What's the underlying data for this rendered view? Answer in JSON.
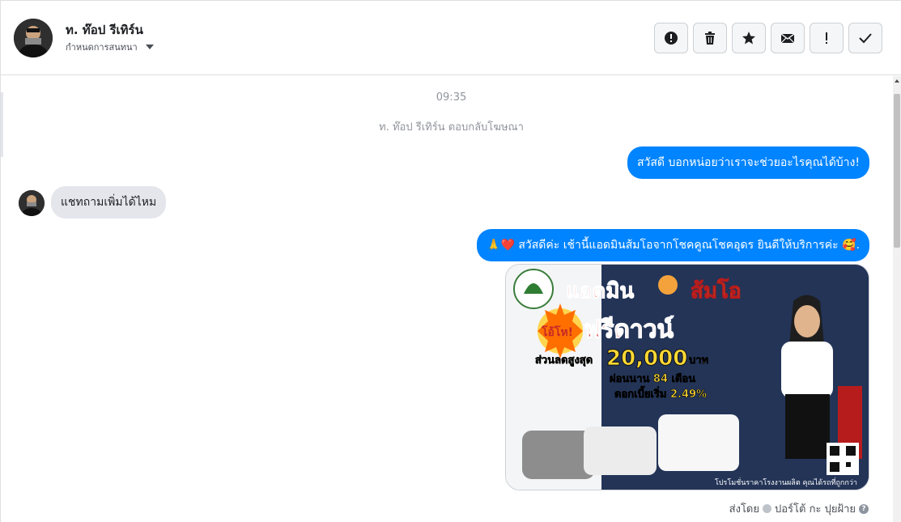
{
  "header": {
    "contact_name": "ท. ท๊อป รีเทิร์น",
    "assign_label": "กำหนดการสนทนา",
    "actions": [
      {
        "icon": "alert-circle-icon",
        "name": "mark-spam-button"
      },
      {
        "icon": "trash-icon",
        "name": "delete-button"
      },
      {
        "icon": "star-icon",
        "name": "star-button"
      },
      {
        "icon": "envelope-icon",
        "name": "mark-unread-button"
      },
      {
        "icon": "exclamation-icon",
        "name": "follow-up-button"
      },
      {
        "icon": "check-icon",
        "name": "mark-done-button"
      }
    ]
  },
  "thread": {
    "timestamp": "09:35",
    "system_message": "ท. ท๊อป รีเทิร์น ตอบกลับโฆษณา",
    "messages": [
      {
        "direction": "out",
        "text": "สวัสดี บอกหน่อยว่าเราจะช่วยอะไรคุณได้บ้าง!"
      },
      {
        "direction": "in",
        "text": "แชทถามเพิ่มได้ไหม"
      },
      {
        "direction": "out",
        "text": "🙏❤️ สวัสดีค่ะ เช้านี้แอดมินส้มโอจากโชคคูณโชคอุดร ยินดีให้บริการค่ะ 🥰."
      }
    ],
    "ad": {
      "headline": "แอดมิน",
      "headline2": "ส้มโอ",
      "badge": "โอ้โห!",
      "promo": "ฟรีดาวน์",
      "discount_label": "ส่วนลดสูงสุด",
      "discount_value": "20,000",
      "discount_unit": "บาท",
      "installment": "ผ่อนนาน 84 เดือน",
      "interest": "ดอกเบี้ยเริ่ม 2.49%",
      "footer": "โปรโมชั่นราคาโรงงานผลิต คุณได้รถที่ถูกกว่า"
    },
    "sent_by_label": "ส่งโดย",
    "sent_by_name": "ปอร์โต้ กะ ปุยฝ้าย"
  },
  "colors": {
    "accent": "#0084ff",
    "incoming_bubble": "#e4e6eb",
    "muted_text": "#90949c"
  }
}
